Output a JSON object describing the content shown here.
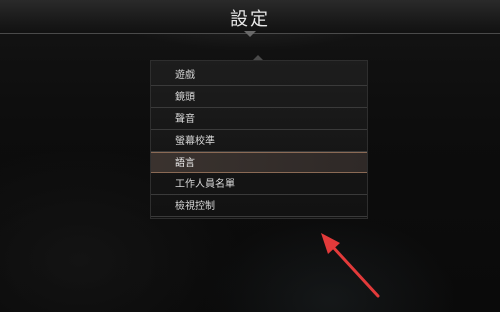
{
  "header": {
    "title": "設定"
  },
  "menu": {
    "items": [
      {
        "label": "遊戲"
      },
      {
        "label": "鏡頭"
      },
      {
        "label": "聲音"
      },
      {
        "label": "螢幕校準"
      },
      {
        "label": "語言"
      },
      {
        "label": "工作人員名單"
      },
      {
        "label": "檢視控制"
      }
    ],
    "selected_index": 4
  },
  "annotation": {
    "arrow_color": "#e23a3a"
  },
  "colors": {
    "background": "#0b0b0b",
    "text": "#d8d8d8",
    "selected_border": "#8a6a55"
  }
}
